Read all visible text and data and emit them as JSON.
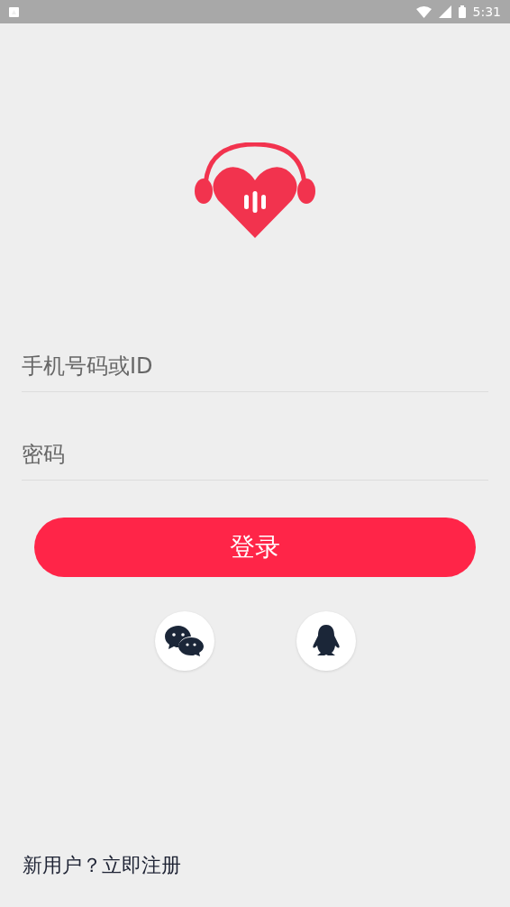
{
  "status_bar": {
    "time": "5:31"
  },
  "form": {
    "fields": [
      {
        "placeholder": "手机号码或ID"
      },
      {
        "placeholder": "密码"
      }
    ],
    "login_button": "登录"
  },
  "social_logins": [
    {
      "kind": "chat"
    },
    {
      "kind": "penguin"
    }
  ],
  "register_link": "新用户？立即注册"
}
